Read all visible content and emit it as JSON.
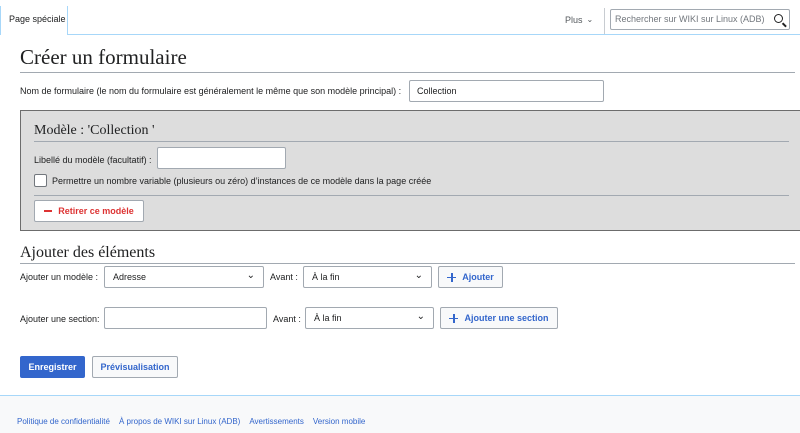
{
  "header": {
    "tab_label": "Page spéciale",
    "more_label": "Plus",
    "search_placeholder": "Rechercher sur WIKI sur Linux (ADB)"
  },
  "page": {
    "title": "Créer un formulaire",
    "form_name_label": "Nom de formulaire (le nom du formulaire est généralement le même que son modèle principal) :",
    "form_name_value": "Collection"
  },
  "template_panel": {
    "title": "Modèle : 'Collection  '",
    "label_label": "Libellé du modèle (facultatif) :",
    "label_value": "",
    "multiple_label": "Permettre un nombre variable (plusieurs ou zéro) d’instances de ce modèle dans la page créée",
    "multiple_checked": false,
    "remove_button": "Retirer ce modèle"
  },
  "add_elements": {
    "title": "Ajouter des éléments",
    "template_label": "Ajouter un modèle :",
    "template_selected": "Adresse",
    "before_label": "Avant :",
    "before_selected": "À la fin",
    "add_button": "Ajouter",
    "section_label": "Ajouter une section:",
    "section_value": "",
    "before_label_2": "Avant :",
    "before_selected_2": "À la fin",
    "add_section_button": "Ajouter une section"
  },
  "actions": {
    "save_button": "Enregistrer",
    "preview_button": "Prévisualisation"
  },
  "footer": {
    "links": [
      "Politique de confidentialité",
      "À propos de WIKI sur Linux (ADB)",
      "Avertissements",
      "Version mobile"
    ]
  },
  "colors": {
    "accent": "#3366cc",
    "destructive": "#dd3333",
    "panel_bg": "#dddddd"
  }
}
